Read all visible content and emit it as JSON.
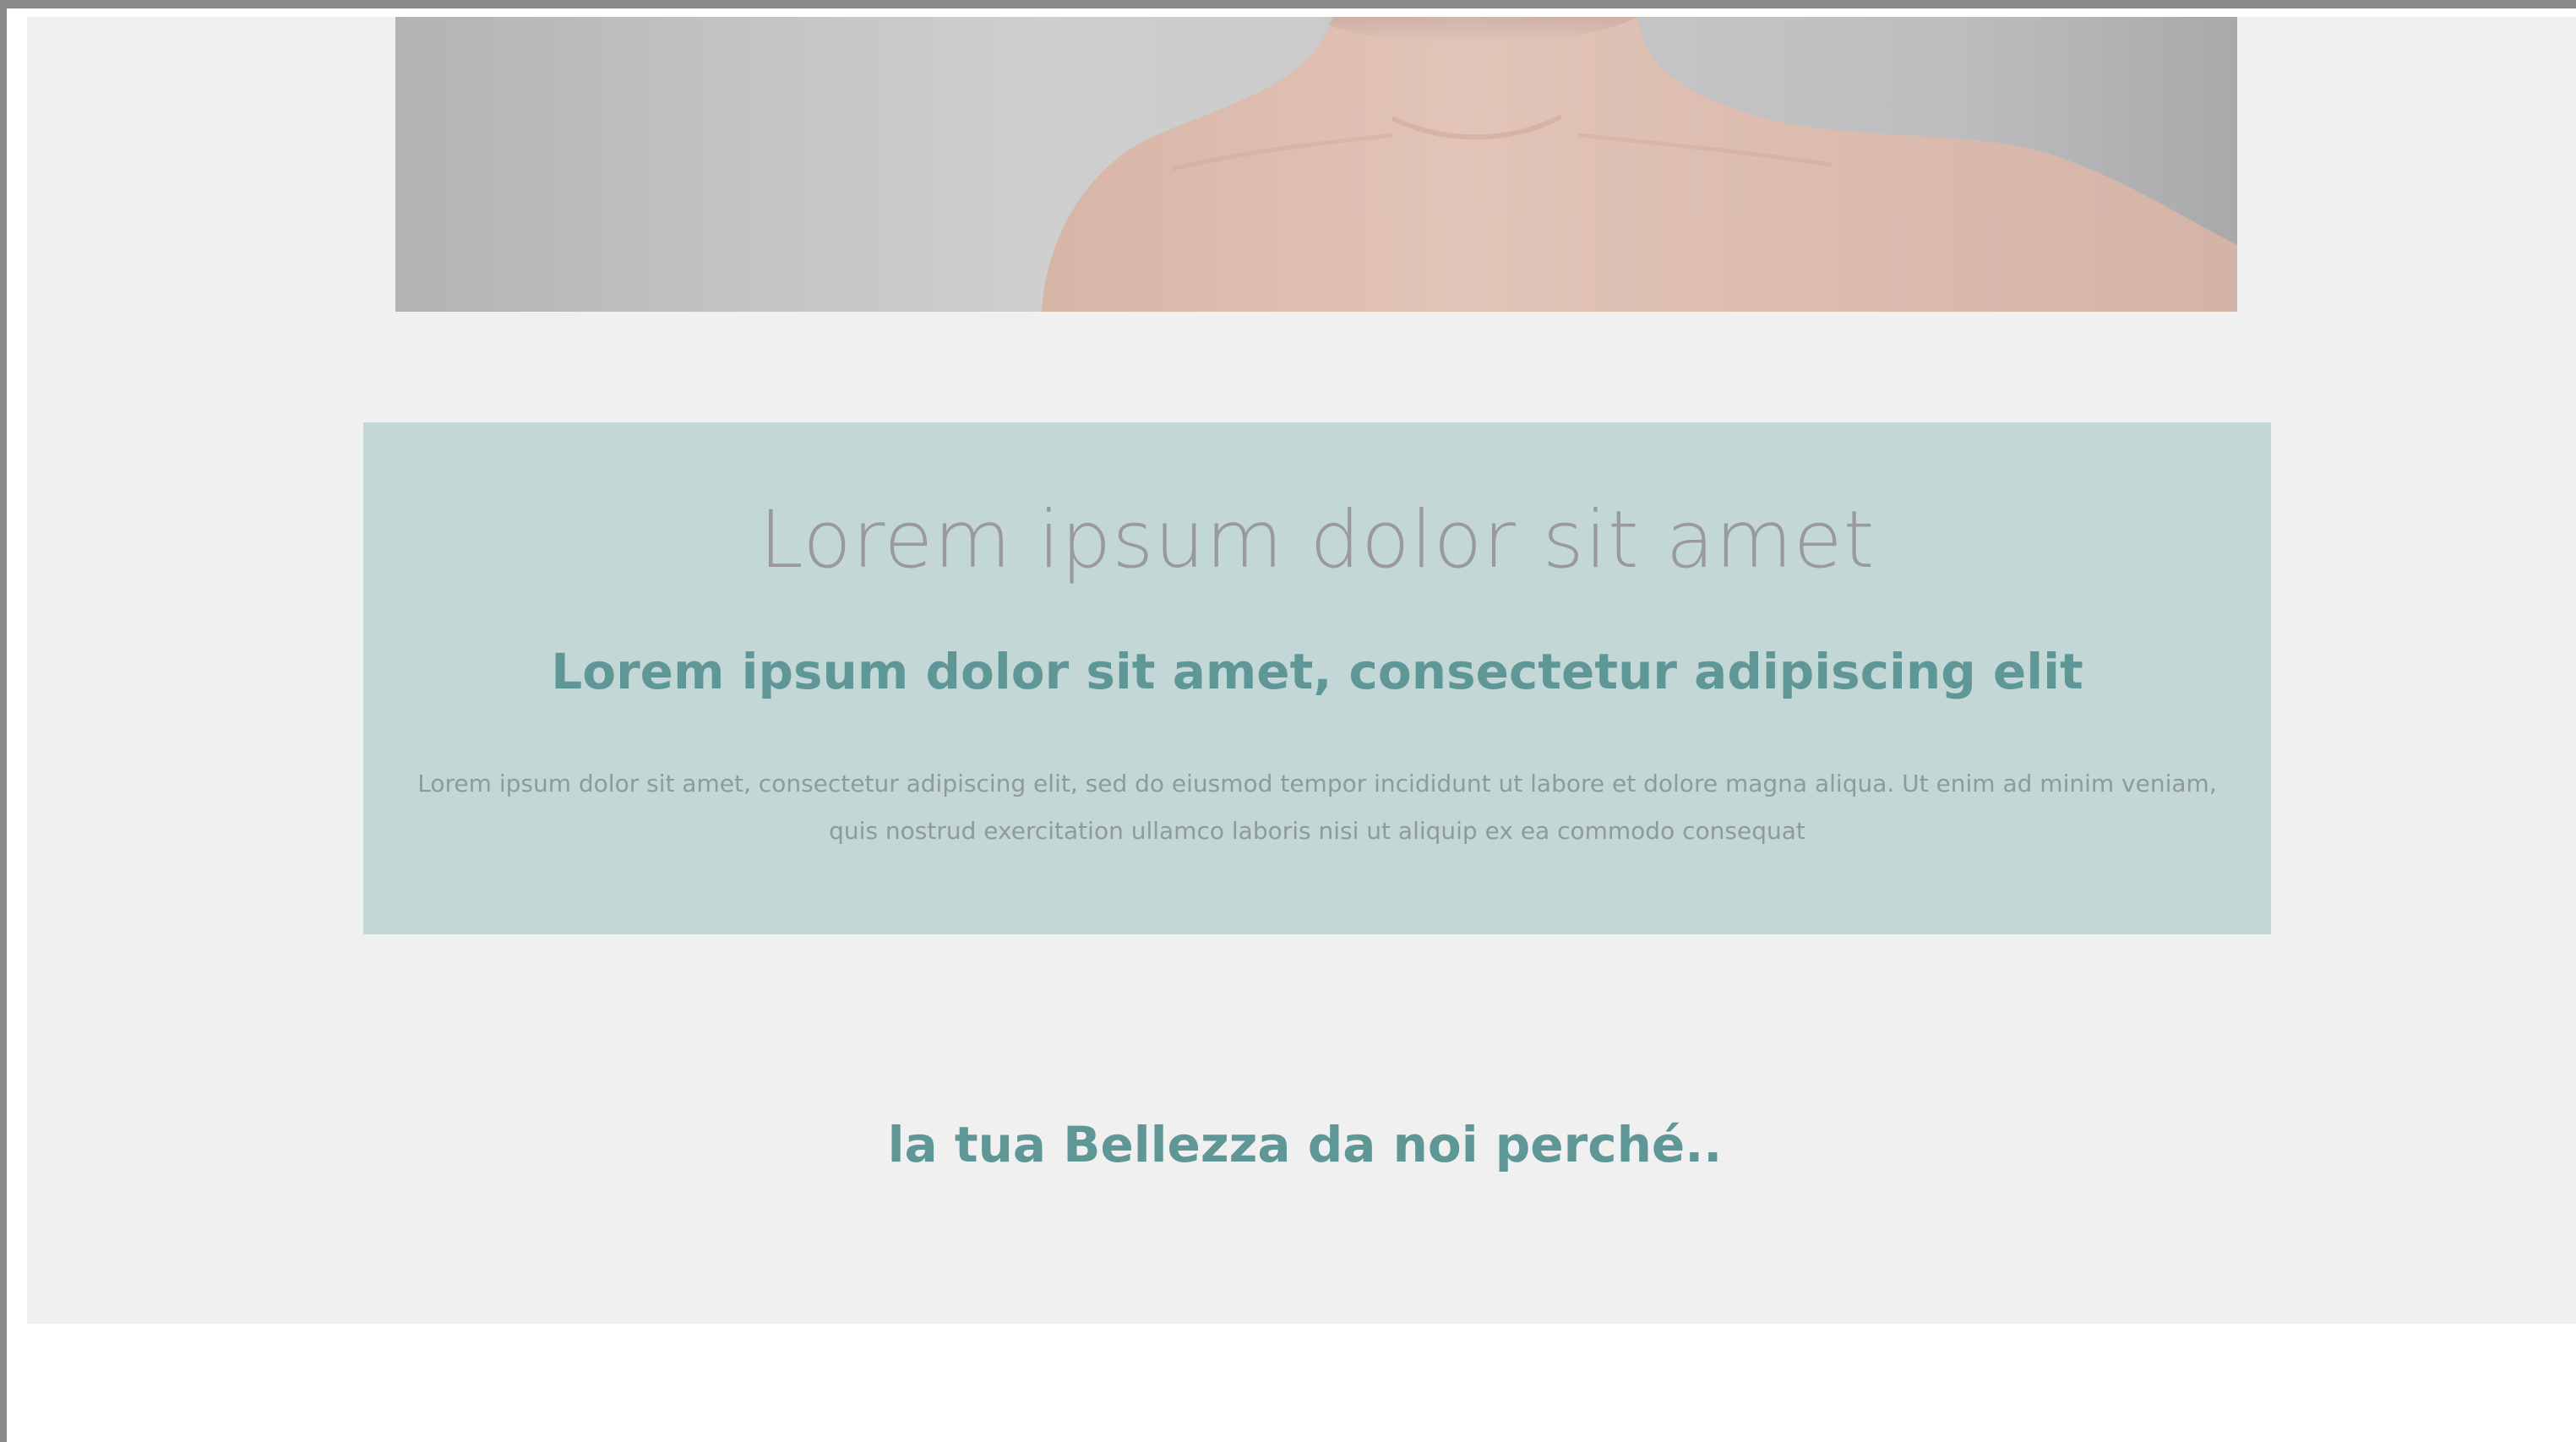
{
  "hero": {
    "image_alt": "bare shoulders and neck on grey background"
  },
  "card": {
    "title": "Lorem ipsum dolor sit amet",
    "subtitle": "Lorem ipsum dolor sit amet, consectetur adipiscing elit",
    "body": "Lorem ipsum dolor sit amet, consectetur adipiscing elit, sed do eiusmod tempor incididunt ut labore et dolore magna aliqua. Ut enim ad minim veniam, quis nostrud exercitation ullamco laboris nisi ut aliquip ex ea commodo consequat",
    "background_color": "#c3d7d7",
    "accent_color": "#5f9797"
  },
  "section": {
    "heading": "la tua Bellezza da noi perché.."
  }
}
